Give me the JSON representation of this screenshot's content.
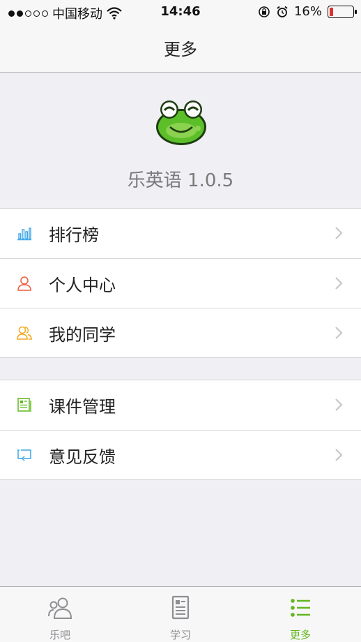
{
  "status_bar": {
    "carrier": "中国移动",
    "time": "14:46",
    "battery_percent": "16%",
    "signal_dots_filled": 2,
    "signal_dots_total": 5,
    "battery_level": 0.16,
    "battery_color": "#e0302e"
  },
  "nav": {
    "title": "更多"
  },
  "header": {
    "app_version": "乐英语 1.0.5",
    "logo_icon": "frog-mascot-icon"
  },
  "menu_group_1": [
    {
      "label": "排行榜",
      "icon": "ranking-bars-icon",
      "color": "#3da6e8"
    },
    {
      "label": "个人中心",
      "icon": "person-icon",
      "color": "#f05a3a"
    },
    {
      "label": "我的同学",
      "icon": "classmates-icon",
      "color": "#f2a81d"
    }
  ],
  "menu_group_2": [
    {
      "label": "课件管理",
      "icon": "courseware-icon",
      "color": "#62b81f"
    },
    {
      "label": "意见反馈",
      "icon": "feedback-icon",
      "color": "#3da6e8"
    }
  ],
  "tab_bar": {
    "tabs": [
      {
        "label": "乐吧",
        "icon": "people-icon",
        "active": false
      },
      {
        "label": "学习",
        "icon": "document-icon",
        "active": false
      },
      {
        "label": "更多",
        "icon": "list-icon",
        "active": true
      }
    ],
    "active_color": "#62b81f",
    "inactive_color": "#8e8e93"
  }
}
